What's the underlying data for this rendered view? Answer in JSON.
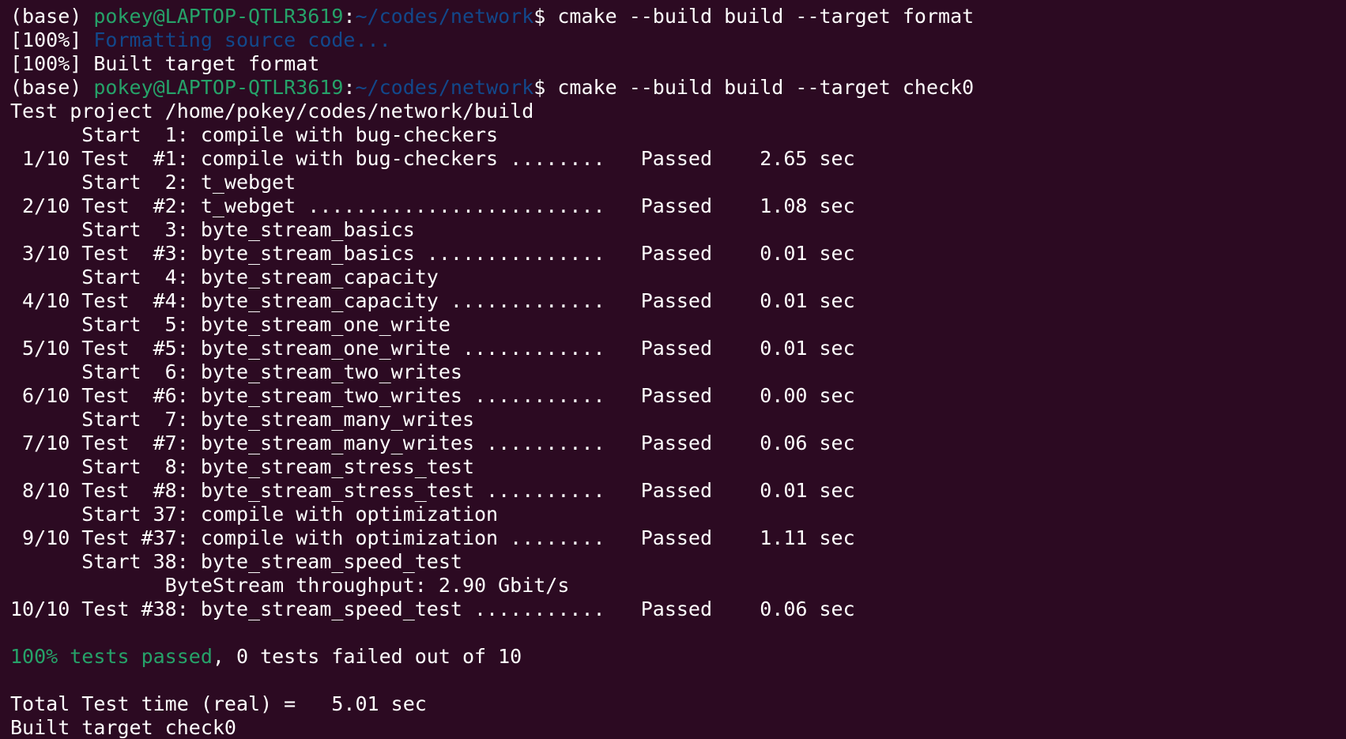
{
  "colors": {
    "background": "#2c0a22",
    "foreground": "#ffffff",
    "prompt_user": "#26a269",
    "prompt_path": "#12488b",
    "status_text": "#12488b",
    "passed_summary": "#26a269"
  },
  "lines": [
    {
      "segments": [
        {
          "text": "(base) ",
          "color": "white"
        },
        {
          "text": "pokey@LAPTOP-QTLR3619",
          "color": "green"
        },
        {
          "text": ":",
          "color": "white"
        },
        {
          "text": "~/codes/network",
          "color": "blue"
        },
        {
          "text": "$ cmake --build build --target format",
          "color": "white"
        }
      ]
    },
    {
      "segments": [
        {
          "text": "[100%] ",
          "color": "white"
        },
        {
          "text": "Formatting source code...",
          "color": "blue"
        }
      ]
    },
    {
      "segments": [
        {
          "text": "[100%] Built target format",
          "color": "white"
        }
      ]
    },
    {
      "segments": [
        {
          "text": "(base) ",
          "color": "white"
        },
        {
          "text": "pokey@LAPTOP-QTLR3619",
          "color": "green"
        },
        {
          "text": ":",
          "color": "white"
        },
        {
          "text": "~/codes/network",
          "color": "blue"
        },
        {
          "text": "$ cmake --build build --target check0",
          "color": "white"
        }
      ]
    },
    {
      "segments": [
        {
          "text": "Test project /home/pokey/codes/network/build",
          "color": "white"
        }
      ]
    },
    {
      "segments": [
        {
          "text": "      Start  1: compile with bug-checkers",
          "color": "white"
        }
      ]
    },
    {
      "segments": [
        {
          "text": " 1/10 Test  #1: compile with bug-checkers ........   Passed    2.65 sec",
          "color": "white"
        }
      ]
    },
    {
      "segments": [
        {
          "text": "      Start  2: t_webget",
          "color": "white"
        }
      ]
    },
    {
      "segments": [
        {
          "text": " 2/10 Test  #2: t_webget .........................   Passed    1.08 sec",
          "color": "white"
        }
      ]
    },
    {
      "segments": [
        {
          "text": "      Start  3: byte_stream_basics",
          "color": "white"
        }
      ]
    },
    {
      "segments": [
        {
          "text": " 3/10 Test  #3: byte_stream_basics ...............   Passed    0.01 sec",
          "color": "white"
        }
      ]
    },
    {
      "segments": [
        {
          "text": "      Start  4: byte_stream_capacity",
          "color": "white"
        }
      ]
    },
    {
      "segments": [
        {
          "text": " 4/10 Test  #4: byte_stream_capacity .............   Passed    0.01 sec",
          "color": "white"
        }
      ]
    },
    {
      "segments": [
        {
          "text": "      Start  5: byte_stream_one_write",
          "color": "white"
        }
      ]
    },
    {
      "segments": [
        {
          "text": " 5/10 Test  #5: byte_stream_one_write ............   Passed    0.01 sec",
          "color": "white"
        }
      ]
    },
    {
      "segments": [
        {
          "text": "      Start  6: byte_stream_two_writes",
          "color": "white"
        }
      ]
    },
    {
      "segments": [
        {
          "text": " 6/10 Test  #6: byte_stream_two_writes ...........   Passed    0.00 sec",
          "color": "white"
        }
      ]
    },
    {
      "segments": [
        {
          "text": "      Start  7: byte_stream_many_writes",
          "color": "white"
        }
      ]
    },
    {
      "segments": [
        {
          "text": " 7/10 Test  #7: byte_stream_many_writes ..........   Passed    0.06 sec",
          "color": "white"
        }
      ]
    },
    {
      "segments": [
        {
          "text": "      Start  8: byte_stream_stress_test",
          "color": "white"
        }
      ]
    },
    {
      "segments": [
        {
          "text": " 8/10 Test  #8: byte_stream_stress_test ..........   Passed    0.01 sec",
          "color": "white"
        }
      ]
    },
    {
      "segments": [
        {
          "text": "      Start 37: compile with optimization",
          "color": "white"
        }
      ]
    },
    {
      "segments": [
        {
          "text": " 9/10 Test #37: compile with optimization ........   Passed    1.11 sec",
          "color": "white"
        }
      ]
    },
    {
      "segments": [
        {
          "text": "      Start 38: byte_stream_speed_test",
          "color": "white"
        }
      ]
    },
    {
      "segments": [
        {
          "text": "             ByteStream throughput: 2.90 Gbit/s",
          "color": "white"
        }
      ]
    },
    {
      "segments": [
        {
          "text": "10/10 Test #38: byte_stream_speed_test ...........   Passed    0.06 sec",
          "color": "white"
        }
      ]
    },
    {
      "segments": [
        {
          "text": "",
          "color": "white"
        }
      ]
    },
    {
      "segments": [
        {
          "text": "100% tests passed",
          "color": "green"
        },
        {
          "text": ", 0 tests failed out of 10",
          "color": "white"
        }
      ]
    },
    {
      "segments": [
        {
          "text": "",
          "color": "white"
        }
      ]
    },
    {
      "segments": [
        {
          "text": "Total Test time (real) =   5.01 sec",
          "color": "white"
        }
      ]
    },
    {
      "segments": [
        {
          "text": "Built target check0",
          "color": "white"
        }
      ]
    }
  ]
}
